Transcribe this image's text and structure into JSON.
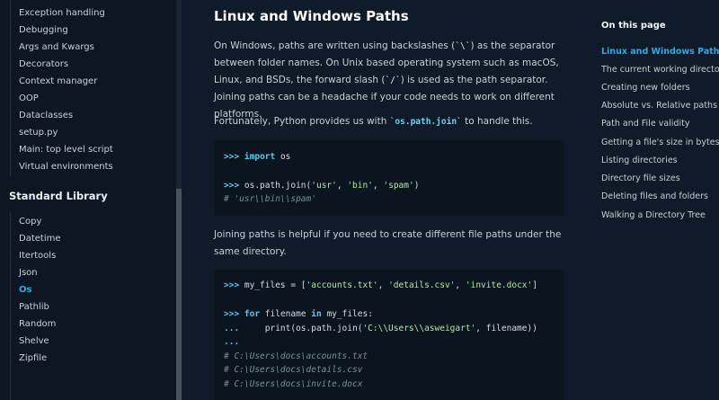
{
  "sidebar": {
    "top_items": [
      "Exception handling",
      "Debugging",
      "Args and Kwargs",
      "Decorators",
      "Context manager",
      "OOP",
      "Dataclasses",
      "setup.py",
      "Main: top level script",
      "Virtual environments"
    ],
    "section_heading": "Standard Library",
    "stdlib_items": [
      "Copy",
      "Datetime",
      "Itertools",
      "Json",
      "Os",
      "Pathlib",
      "Random",
      "Shelve",
      "Zipfile"
    ],
    "active_item": "Os"
  },
  "main": {
    "title": "Linux and Windows Paths",
    "para1": {
      "t1": "On Windows, paths are written using backslashes (",
      "c1": "`\\`",
      "t2": ") as the separator between folder names. On Unix based operating system such as macOS, Linux, and BSDs, the forward slash (",
      "c2": "`/`",
      "t3": ") is used as the path separator. Joining paths can be a headache if your code needs to work on different platforms."
    },
    "para2": {
      "t1": "Fortunately, Python provides us with ",
      "c1": "`os.path.join`",
      "t2": " to handle this."
    },
    "code1": {
      "l1_prompt": ">>>",
      "l1_kw": "import",
      "l1_rest": " os",
      "l2_prompt": ">>>",
      "l2_a": " os.path.join(",
      "l2_s1": "'usr'",
      "l2_b": ", ",
      "l2_s2": "'bin'",
      "l2_c": ", ",
      "l2_s3": "'spam'",
      "l2_d": ")",
      "l3": "# 'usr\\\\bin\\\\spam'"
    },
    "para3": "Joining paths is helpful if you need to create different file paths under the same directory.",
    "code2": {
      "l1_prompt": ">>>",
      "l1_a": " my_files = [",
      "l1_s1": "'accounts.txt'",
      "l1_b": ", ",
      "l1_s2": "'details.csv'",
      "l1_c": ", ",
      "l1_s3": "'invite.docx'",
      "l1_d": "]",
      "l2_prompt": ">>>",
      "l2_kw1": "for",
      "l2_a": " filename ",
      "l2_kw2": "in",
      "l2_b": " my_files:",
      "l3_prompt": "...",
      "l3_a": "     print(os.path.join(",
      "l3_s": "'C:\\\\Users\\\\asweigart'",
      "l3_b": ", filename))",
      "l4": "...",
      "l5": "# C:\\Users\\docs\\accounts.txt",
      "l6": "# C:\\Users\\docs\\details.csv",
      "l7": "# C:\\Users\\docs\\invite.docx"
    }
  },
  "toc": {
    "heading": "On this page",
    "items": [
      "Linux and Windows Paths",
      "The current working directory",
      "Creating new folders",
      "Absolute vs. Relative paths",
      "Path and File validity",
      "Getting a file's size in bytes",
      "Listing directories",
      "Directory file sizes",
      "Deleting files and folders",
      "Walking a Directory Tree"
    ]
  }
}
